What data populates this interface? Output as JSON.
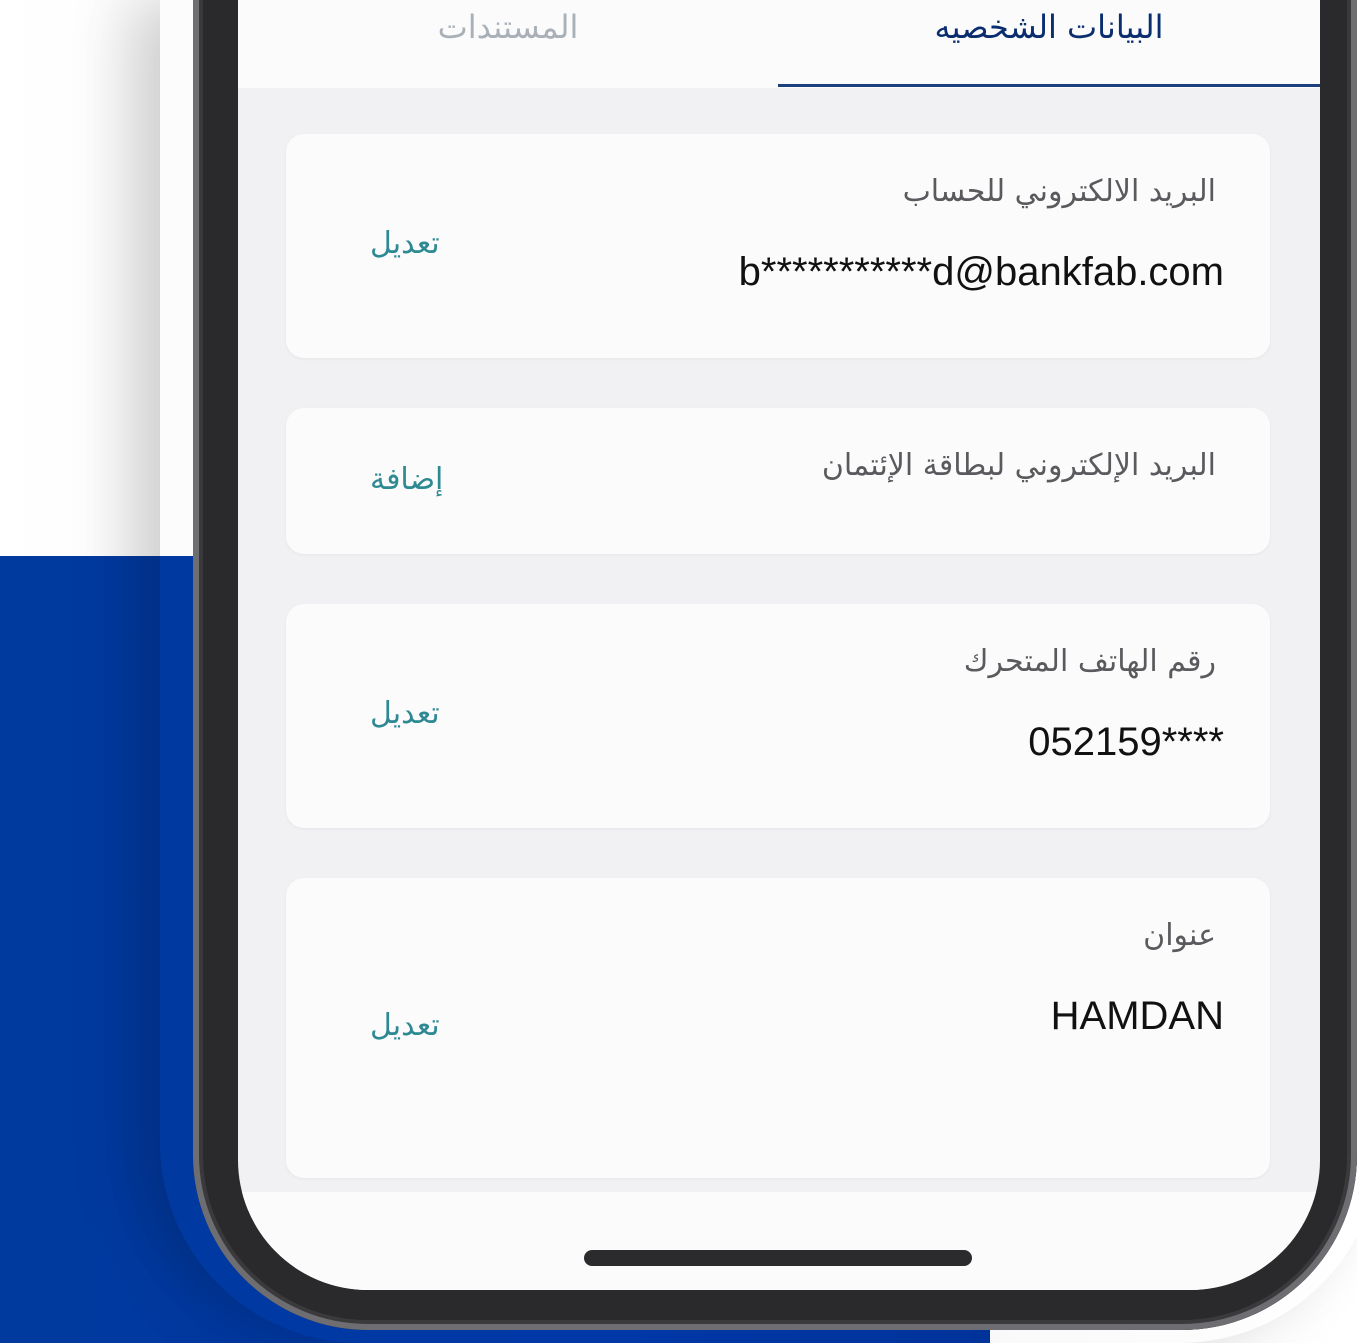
{
  "tabs": {
    "documents": "المستندات",
    "personal": "البيانات الشخصيه"
  },
  "cards": [
    {
      "label": "البريد الالكتروني للحساب",
      "value": "b***********d@bankfab.com",
      "action": "تعديل"
    },
    {
      "label": "البريد الإلكتروني لبطاقة الإئتمان",
      "action": "إضافة"
    },
    {
      "label": "رقم الهاتف المتحرك",
      "value": "052159****",
      "action": "تعديل"
    },
    {
      "label": "عنوان",
      "value": "HAMDAN",
      "action": "تعديل"
    }
  ],
  "colors": {
    "accent": "#2d8a93",
    "tab_active": "#0a2d6e",
    "brand_blue": "#0038a8"
  }
}
